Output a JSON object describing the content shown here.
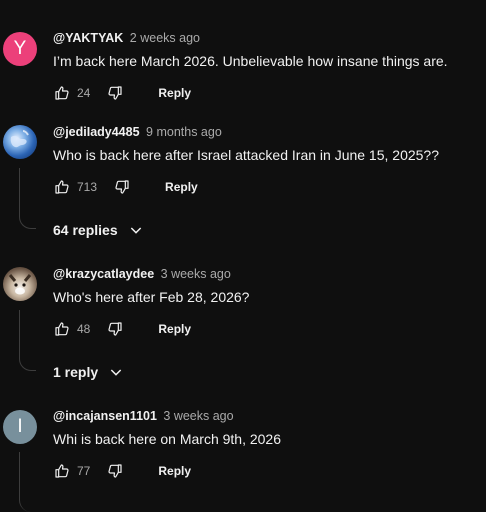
{
  "comments": [
    {
      "author": "@YAKTYAK",
      "time": "2 weeks ago",
      "text": "I’m back here March 2026. Unbelievable how insane things are.",
      "likes": "24",
      "reply_label": "Reply",
      "avatar_letter": "Y",
      "avatar_color": "#ec407a"
    },
    {
      "author": "@jediIady4485",
      "time": "9 months ago",
      "text": "Who is back here after Israel attacked Iran in June 15, 2025??",
      "likes": "713",
      "reply_label": "Reply",
      "replies_label": "64 replies"
    },
    {
      "author": "@krazycatlaydee",
      "time": "3 weeks ago",
      "text": "Who's here after Feb 28, 2026?",
      "likes": "48",
      "reply_label": "Reply",
      "replies_label": "1 reply"
    },
    {
      "author": "@incajansen1101",
      "time": "3 weeks ago",
      "text": "Whi is back here on March 9th, 2026",
      "likes": "77",
      "reply_label": "Reply",
      "avatar_letter": "I",
      "avatar_color": "#78909c"
    }
  ]
}
